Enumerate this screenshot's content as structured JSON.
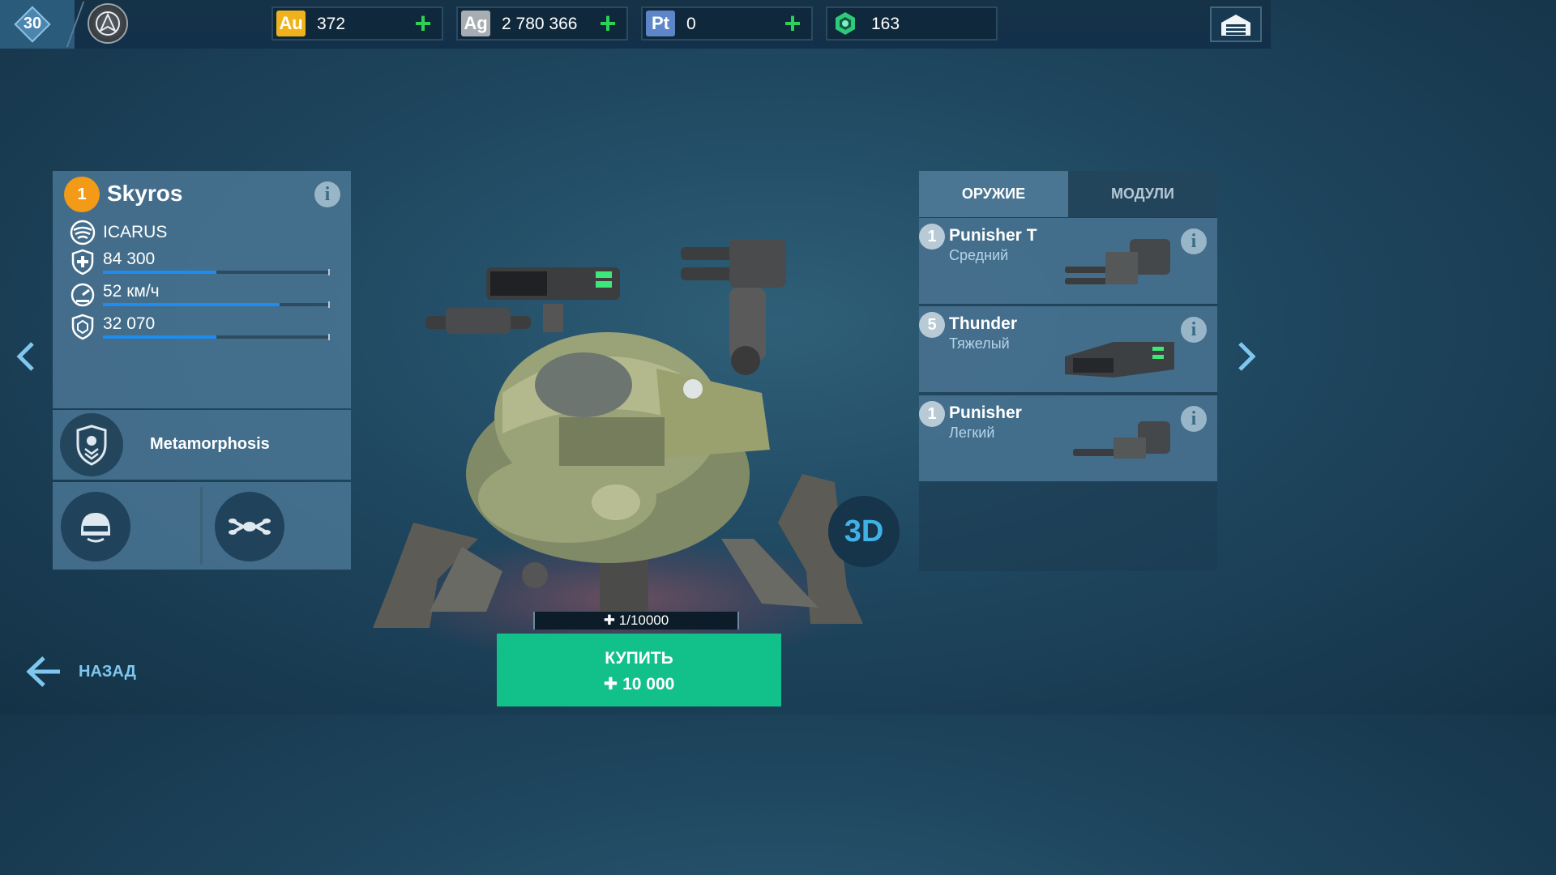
{
  "player": {
    "level": "30"
  },
  "currencies": [
    {
      "code": "Au",
      "value": "372",
      "color": "#f0b21a"
    },
    {
      "code": "Ag",
      "value": "2 780 366",
      "color": "#a7aeb3"
    },
    {
      "code": "Pt",
      "value": "0",
      "color": "#5d86c8"
    },
    {
      "code": "",
      "value": "163",
      "icon": "hex-token-icon",
      "color": "#2ec97a"
    }
  ],
  "robot": {
    "tier": "1",
    "name": "Skyros",
    "faction": "ICARUS",
    "stats": [
      {
        "icon": "health-shield-icon",
        "value": "84 300",
        "level": 0.5
      },
      {
        "icon": "speedometer-icon",
        "value": "52 км/ч",
        "level": 0.78
      },
      {
        "icon": "hex-armor-icon",
        "value": "32 070",
        "level": 0.5
      }
    ],
    "ability": "Metamorphosis"
  },
  "tabs": {
    "weapons": "ОРУЖИЕ",
    "modules": "МОДУЛИ"
  },
  "weapons": [
    {
      "level": "1",
      "name": "Punisher T",
      "class": "Средний"
    },
    {
      "level": "5",
      "name": "Thunder",
      "class": "Тяжелый"
    },
    {
      "level": "1",
      "name": "Punisher",
      "class": "Легкий"
    }
  ],
  "view_3d": "3D",
  "parts_progress": "1/10000",
  "buy": {
    "label": "КУПИТЬ",
    "price": "10 000"
  },
  "back": {
    "label": "НАЗАД"
  }
}
